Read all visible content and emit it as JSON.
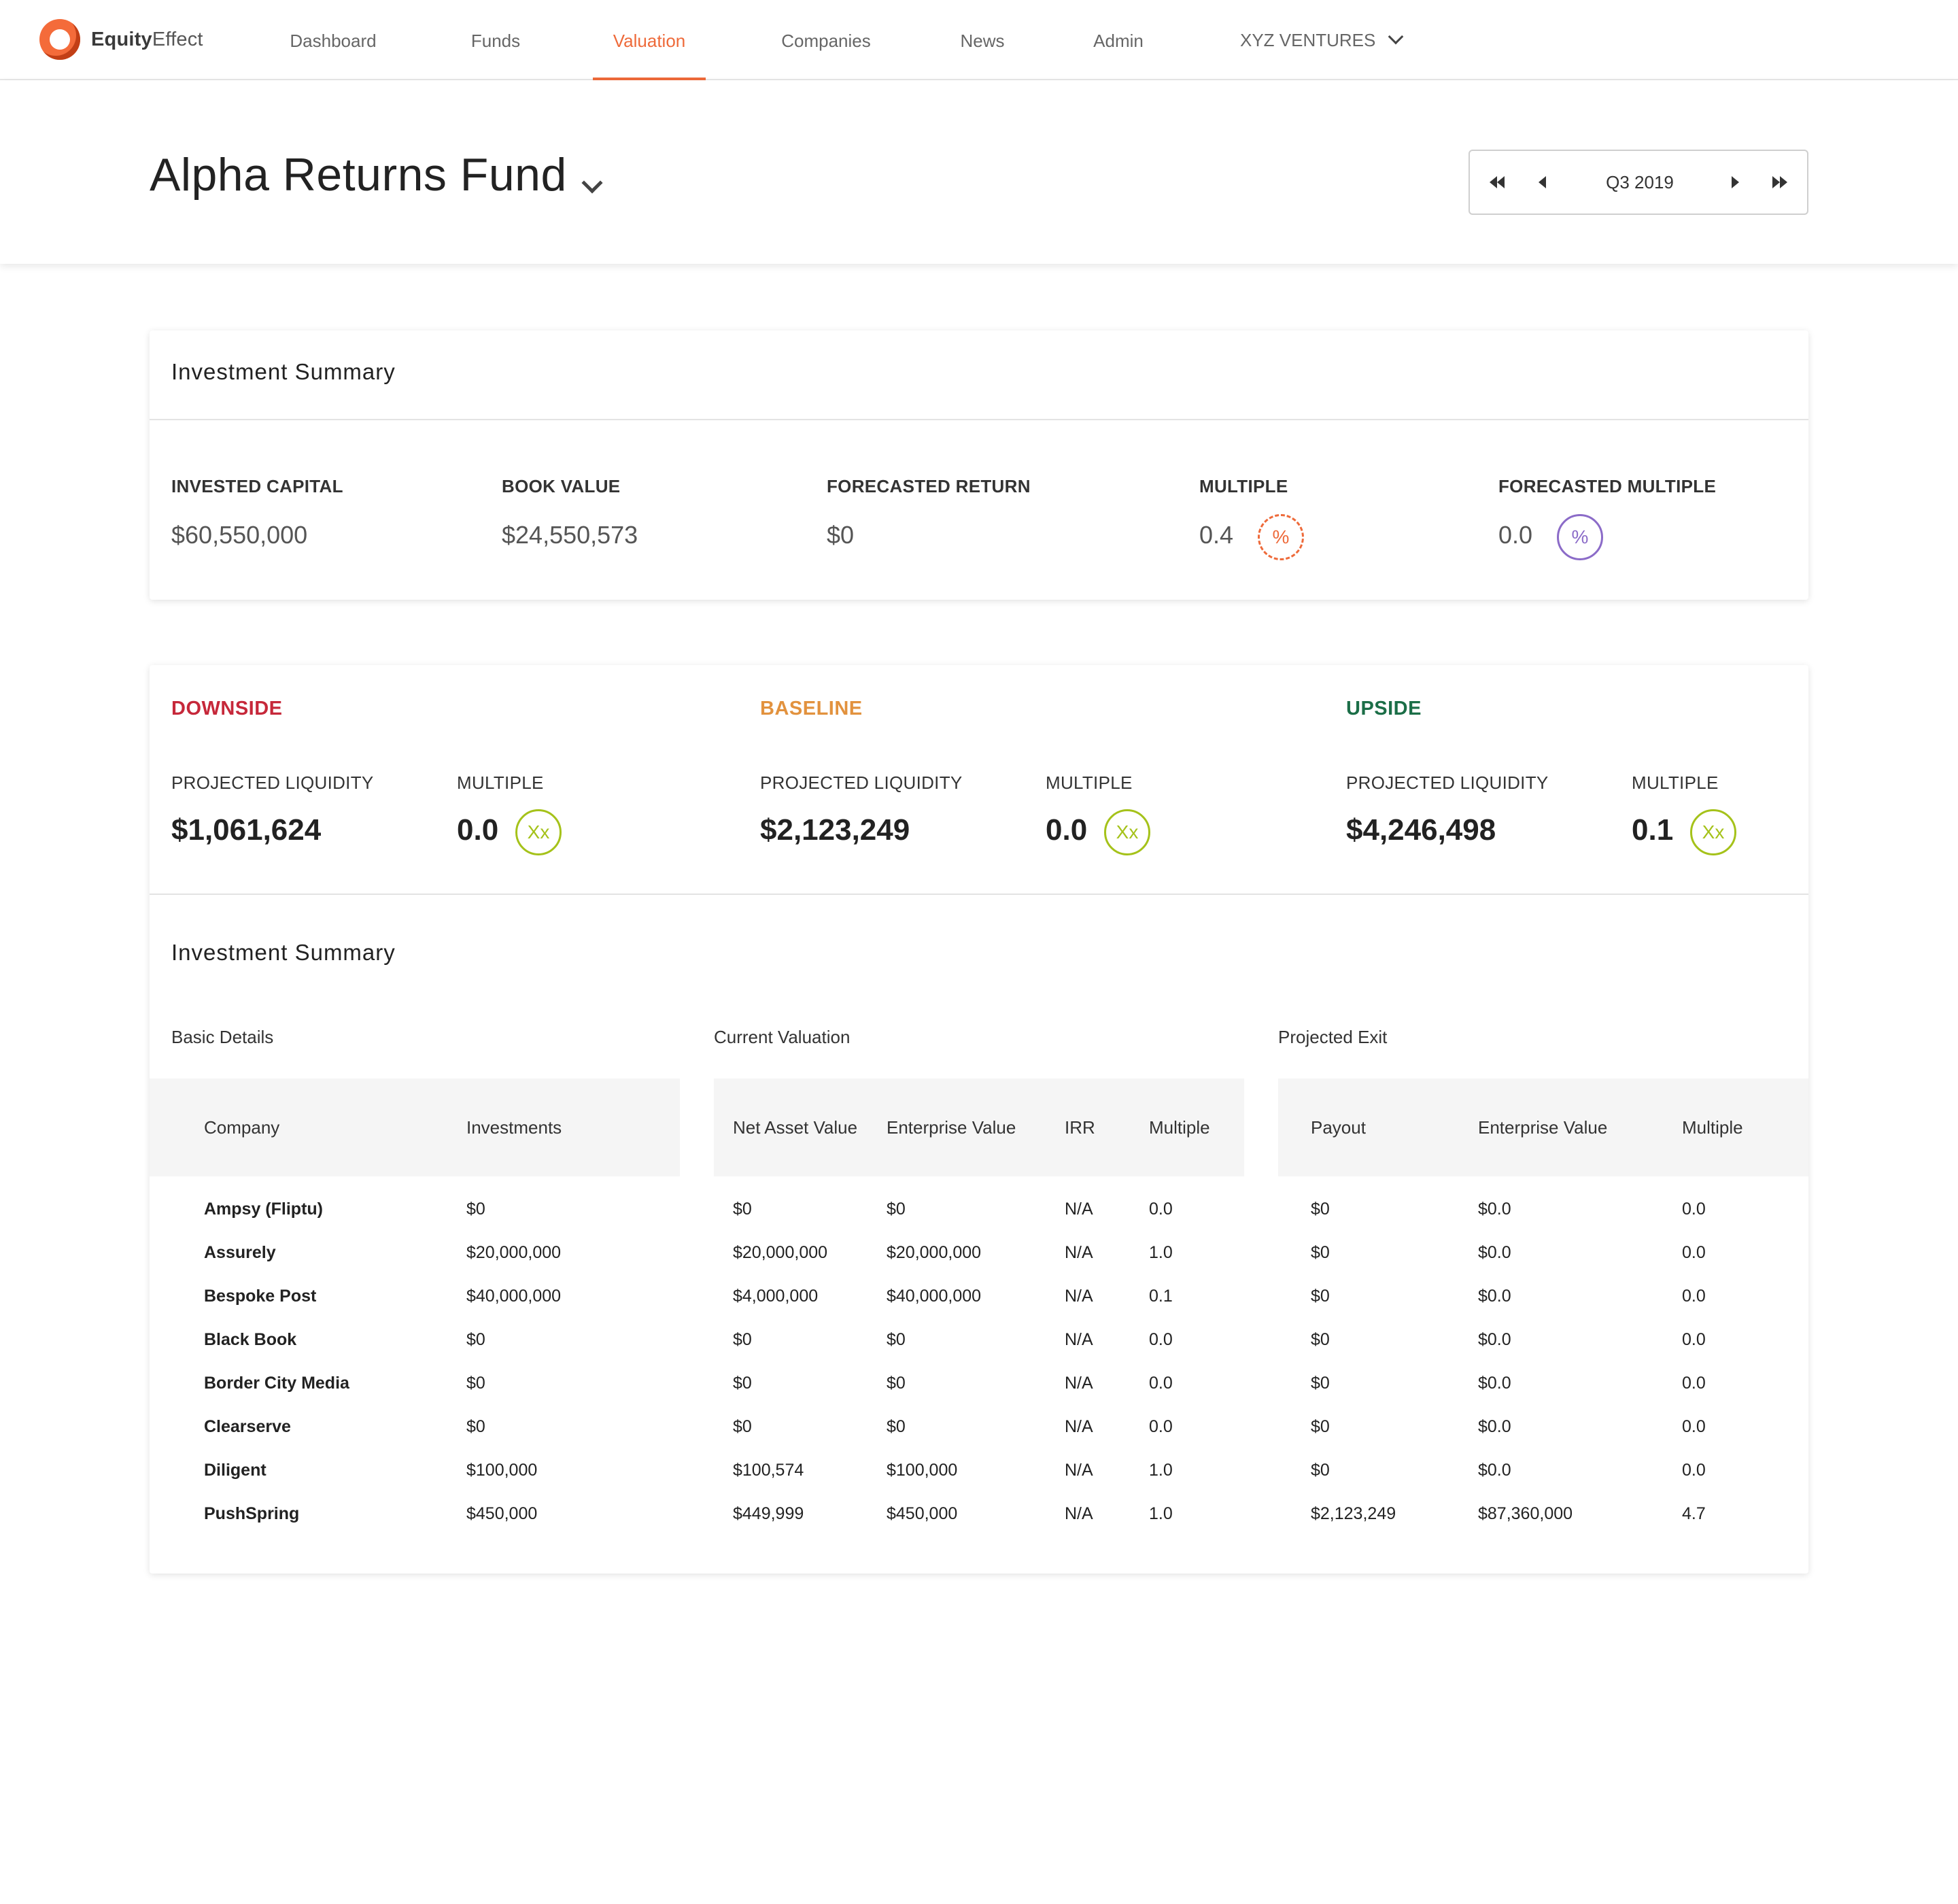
{
  "app": {
    "brand_bold": "Equity",
    "brand_light": "Effect"
  },
  "colors": {
    "accent": "#ee6a3a",
    "downside": "#c6283a",
    "baseline": "#e2923e",
    "upside": "#1b6e47",
    "badge_green": "#a5c21a",
    "badge_purple": "#8b6bc8"
  },
  "nav": {
    "items": [
      {
        "label": "Dashboard"
      },
      {
        "label": "Funds"
      },
      {
        "label": "Valuation",
        "active": true
      },
      {
        "label": "Companies"
      },
      {
        "label": "News"
      },
      {
        "label": "Admin"
      }
    ],
    "org": "XYZ VENTURES"
  },
  "header": {
    "fund_name": "Alpha Returns Fund",
    "period": "Q3 2019"
  },
  "summary": {
    "title": "Investment Summary",
    "stats": [
      {
        "label": "INVESTED CAPITAL",
        "value": "$60,550,000"
      },
      {
        "label": "BOOK VALUE",
        "value": "$24,550,573"
      },
      {
        "label": "FORECASTED RETURN",
        "value": "$0"
      },
      {
        "label": "MULTIPLE",
        "value": "0.4",
        "badge": "%"
      },
      {
        "label": "FORECASTED MULTIPLE",
        "value": "0.0",
        "badge": "%"
      }
    ]
  },
  "scenarios": [
    {
      "name": "DOWNSIDE",
      "liq_label": "PROJECTED LIQUIDITY",
      "liq": "$1,061,624",
      "mult_label": "MULTIPLE",
      "mult": "0.0",
      "badge": "Xx"
    },
    {
      "name": "BASELINE",
      "liq_label": "PROJECTED LIQUIDITY",
      "liq": "$2,123,249",
      "mult_label": "MULTIPLE",
      "mult": "0.0",
      "badge": "Xx"
    },
    {
      "name": "UPSIDE",
      "liq_label": "PROJECTED LIQUIDITY",
      "liq": "$4,246,498",
      "mult_label": "MULTIPLE",
      "mult": "0.1",
      "badge": "Xx"
    }
  ],
  "table": {
    "title": "Investment Summary",
    "groups": [
      "Basic Details",
      "Current Valuation",
      "Projected Exit"
    ],
    "columns": [
      "Company",
      "Investments",
      "Net Asset Value",
      "Enterprise Value",
      "IRR",
      "Multiple",
      "Payout",
      "Enterprise Value",
      "Multiple"
    ],
    "rows": [
      [
        "Ampsy (Fliptu)",
        "$0",
        "$0",
        "$0",
        "N/A",
        "0.0",
        "$0",
        "$0.0",
        "0.0"
      ],
      [
        "Assurely",
        "$20,000,000",
        "$20,000,000",
        "$20,000,000",
        "N/A",
        "1.0",
        "$0",
        "$0.0",
        "0.0"
      ],
      [
        "Bespoke Post",
        "$40,000,000",
        "$4,000,000",
        "$40,000,000",
        "N/A",
        "0.1",
        "$0",
        "$0.0",
        "0.0"
      ],
      [
        "Black Book",
        "$0",
        "$0",
        "$0",
        "N/A",
        "0.0",
        "$0",
        "$0.0",
        "0.0"
      ],
      [
        "Border City Media",
        "$0",
        "$0",
        "$0",
        "N/A",
        "0.0",
        "$0",
        "$0.0",
        "0.0"
      ],
      [
        "Clearserve",
        "$0",
        "$0",
        "$0",
        "N/A",
        "0.0",
        "$0",
        "$0.0",
        "0.0"
      ],
      [
        "Diligent",
        "$100,000",
        "$100,574",
        "$100,000",
        "N/A",
        "1.0",
        "$0",
        "$0.0",
        "0.0"
      ],
      [
        "PushSpring",
        "$450,000",
        "$449,999",
        "$450,000",
        "N/A",
        "1.0",
        "$2,123,249",
        "$87,360,000",
        "4.7"
      ]
    ]
  }
}
